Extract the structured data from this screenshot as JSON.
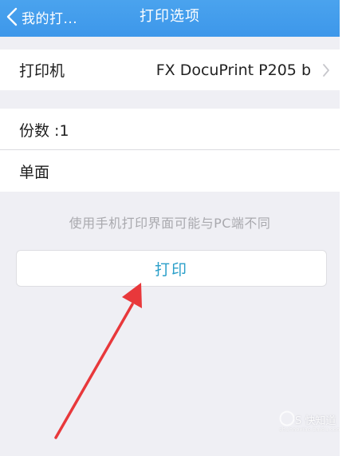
{
  "navbar": {
    "back_label": "我的打...",
    "title": "打印选项",
    "background": "#3d97ea"
  },
  "settings": {
    "printer": {
      "label": "打印机",
      "value": "FX DocuPrint P205 b"
    },
    "copies": {
      "label": "份数 :1"
    },
    "sides": {
      "label": "单面"
    }
  },
  "hint": "使用手机打印界面可能与PC端不同",
  "print_button": {
    "label": "打印",
    "color": "#2a9fc9"
  },
  "annotation": {
    "arrow_color": "#e8383b"
  },
  "watermark": {
    "text": "S 快知道",
    "sub": "shuhaoxiao.baidu.com"
  }
}
